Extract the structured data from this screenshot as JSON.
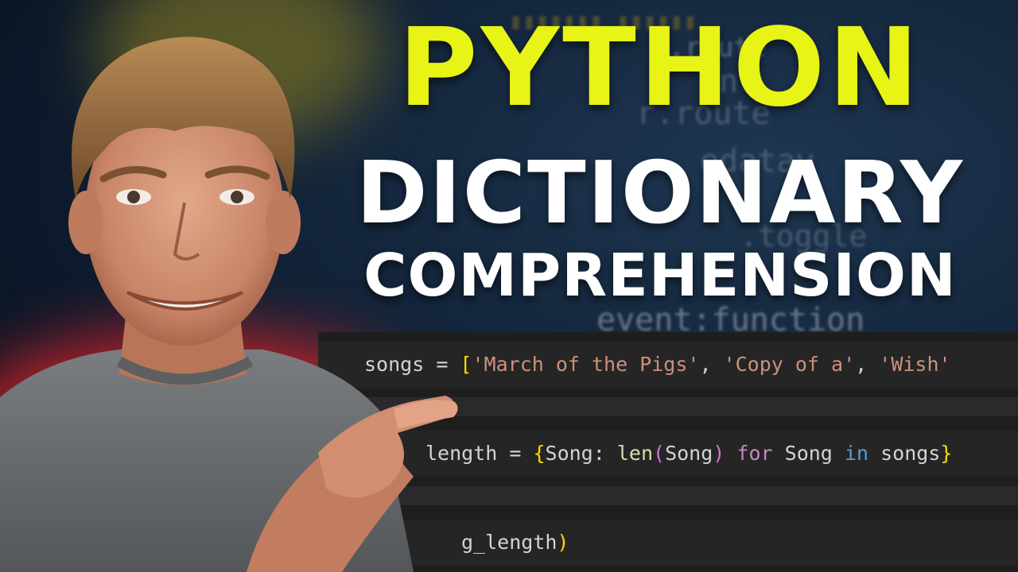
{
  "title": {
    "line1": "PYTHON",
    "line2": "DICTIONARY",
    "line3": "COMPREHENSION"
  },
  "background_code": {
    "line_a": "c.route",
    "line_b": "ent",
    "line_c": "r.route",
    "line_d": "edatav",
    "line_e": ".toggle",
    "line_f": "event:function"
  },
  "code": {
    "line1": {
      "var": "songs",
      "op": " = ",
      "open": "[",
      "s1": "'March of the Pigs'",
      "s2": "'Copy of a'",
      "s3": "'Wish'",
      "sep": ", "
    },
    "line2": {
      "var": "length",
      "op": " = ",
      "open": "{",
      "key": "Song",
      "colon": ": ",
      "fn": "len",
      "po": "(",
      "arg": "Song",
      "pc": ")",
      "for": "for",
      "loopvar": "Song",
      "in": "in",
      "iter": "songs",
      "close": "}"
    },
    "line3": {
      "text": "g_length",
      "close": ")"
    }
  },
  "colors": {
    "title_yellow": "#e8f316",
    "title_white": "#ffffff",
    "editor_bg": "#1e1e1e",
    "string": "#ce9178",
    "bracket": "#ffd700",
    "keyword": "#c586c0"
  }
}
